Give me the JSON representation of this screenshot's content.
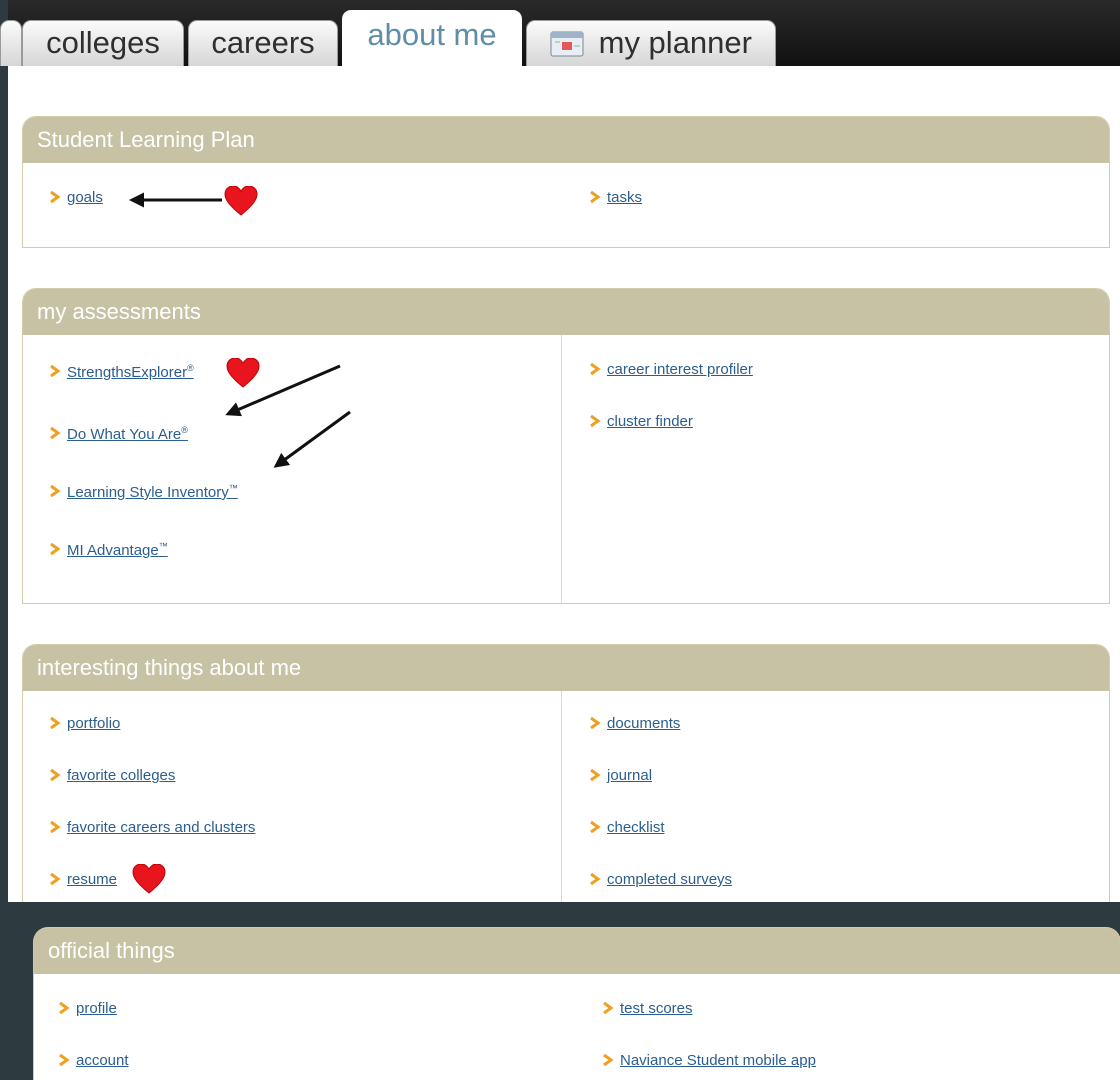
{
  "tabs": [
    {
      "label": "colleges"
    },
    {
      "label": "careers"
    },
    {
      "label": "about me"
    },
    {
      "label": "my planner"
    }
  ],
  "panels": [
    {
      "title": "Student Learning Plan",
      "left": [
        {
          "label": "goals"
        }
      ],
      "right": [
        {
          "label": "tasks"
        }
      ]
    },
    {
      "title": "my assessments",
      "left": [
        {
          "label": "StrengthsExplorer",
          "mark": "®"
        },
        {
          "label": "Do What You Are",
          "mark": "®"
        },
        {
          "label": "Learning Style Inventory",
          "mark": "™"
        },
        {
          "label": "MI Advantage",
          "mark": "™"
        }
      ],
      "right": [
        {
          "label": "career interest profiler"
        },
        {
          "label": "cluster finder"
        }
      ]
    },
    {
      "title": "interesting things about me",
      "left": [
        {
          "label": "portfolio"
        },
        {
          "label": "favorite colleges"
        },
        {
          "label": "favorite careers and clusters"
        },
        {
          "label": "resume"
        }
      ],
      "right": [
        {
          "label": "documents"
        },
        {
          "label": "journal"
        },
        {
          "label": "checklist"
        },
        {
          "label": "completed surveys"
        }
      ]
    },
    {
      "title": "official things",
      "left": [
        {
          "label": "profile"
        },
        {
          "label": "account"
        }
      ],
      "right": [
        {
          "label": "test scores"
        },
        {
          "label": "Naviance Student mobile app"
        }
      ]
    }
  ],
  "colors": {
    "accent": "#c8c2a5",
    "link": "#2b5e8e",
    "chevron": "#f0a020",
    "heart": "#e8141e"
  }
}
